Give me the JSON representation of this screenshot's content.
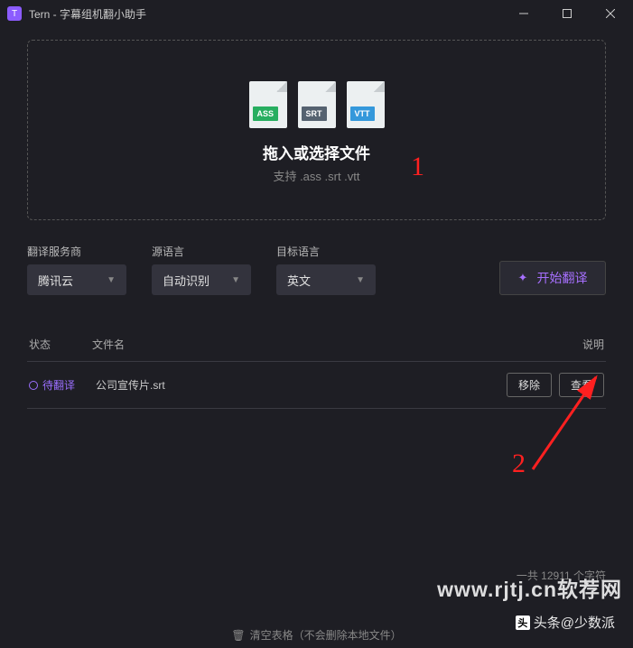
{
  "titlebar": {
    "icon_letter": "T",
    "title": "Tern - 字幕组机翻小助手"
  },
  "dropzone": {
    "title": "拖入或选择文件",
    "subtitle": "支持 .ass .srt .vtt",
    "formats": {
      "ass": "ASS",
      "srt": "SRT",
      "vtt": "VTT"
    }
  },
  "controls": {
    "provider_label": "翻译服务商",
    "provider_value": "腾讯云",
    "source_label": "源语言",
    "source_value": "自动识别",
    "target_label": "目标语言",
    "target_value": "英文",
    "start_label": "开始翻译"
  },
  "table": {
    "col_status": "状态",
    "col_name": "文件名",
    "col_desc": "说明",
    "rows": [
      {
        "status": "待翻译",
        "filename": "公司宣传片.srt",
        "remove": "移除",
        "view": "查看"
      }
    ]
  },
  "footer": {
    "char_count": "一共 12911 个字符",
    "clear_text": "清空表格（不会删除本地文件）"
  },
  "annotations": {
    "one": "1",
    "two": "2"
  },
  "watermarks": {
    "site": "www.rjtj.cn软荐网",
    "toutiao": "头条@少数派"
  }
}
